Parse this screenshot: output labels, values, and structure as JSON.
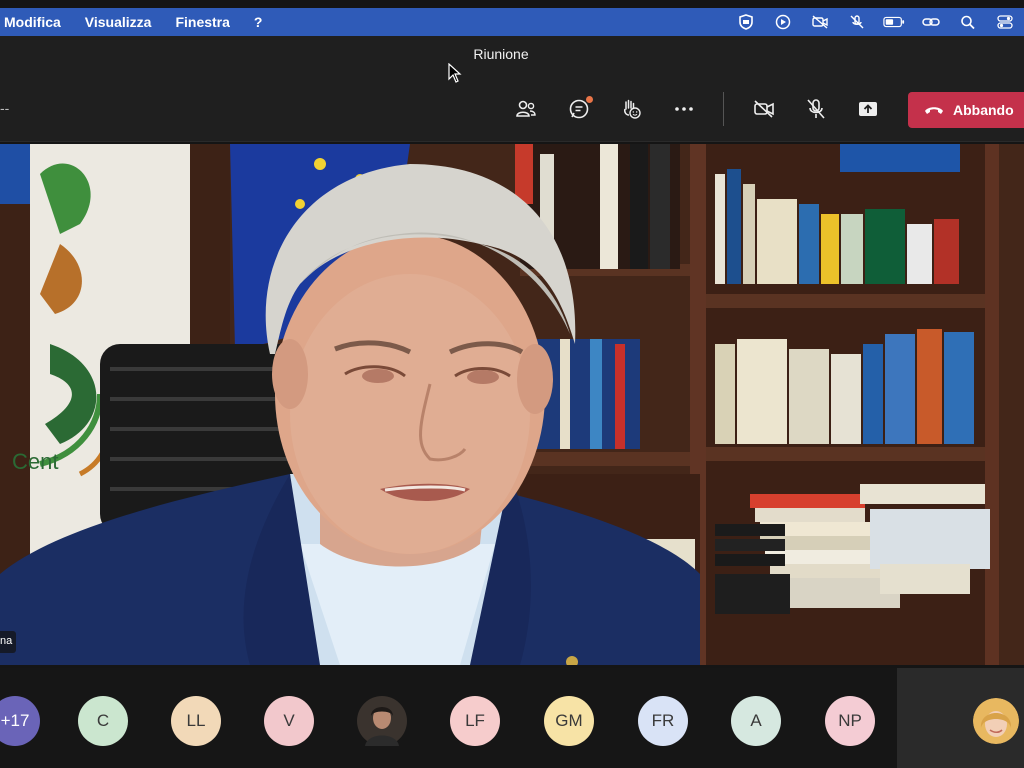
{
  "menubar": {
    "items": [
      "Modifica",
      "Visualizza",
      "Finestra",
      "?"
    ],
    "tray_icons": [
      "shield-icon",
      "play-circle-icon",
      "video-off-icon",
      "mic-off-icon",
      "battery-icon",
      "link-icon",
      "search-icon",
      "control-center-icon"
    ]
  },
  "window": {
    "title": "Riunione"
  },
  "toolbar": {
    "left_text": "--",
    "buttons": [
      "people-icon",
      "chat-icon",
      "reactions-icon",
      "more-icon",
      "camera-off-icon",
      "mic-off-icon",
      "share-icon"
    ],
    "leave_label": "Abbando"
  },
  "speaker": {
    "name_tag": "na"
  },
  "participants": {
    "overflow": "+17",
    "avatars": [
      {
        "initials": "C",
        "color": "#cbe6cf"
      },
      {
        "initials": "LL",
        "color": "#f2d9b8"
      },
      {
        "initials": "V",
        "color": "#f2c8cc"
      },
      {
        "initials": "",
        "color": "#3a332e",
        "photo": true
      },
      {
        "initials": "LF",
        "color": "#f6cccc"
      },
      {
        "initials": "GM",
        "color": "#f7e3a6"
      },
      {
        "initials": "FR",
        "color": "#d9e3f6"
      },
      {
        "initials": "A",
        "color": "#d6e8e0"
      },
      {
        "initials": "NP",
        "color": "#f4ccd4"
      }
    ],
    "overflow_color": "#6a64b8"
  },
  "colors": {
    "menubar": "#2f5bb8",
    "leave": "#c4314b",
    "chat_badge": "#e97548"
  }
}
